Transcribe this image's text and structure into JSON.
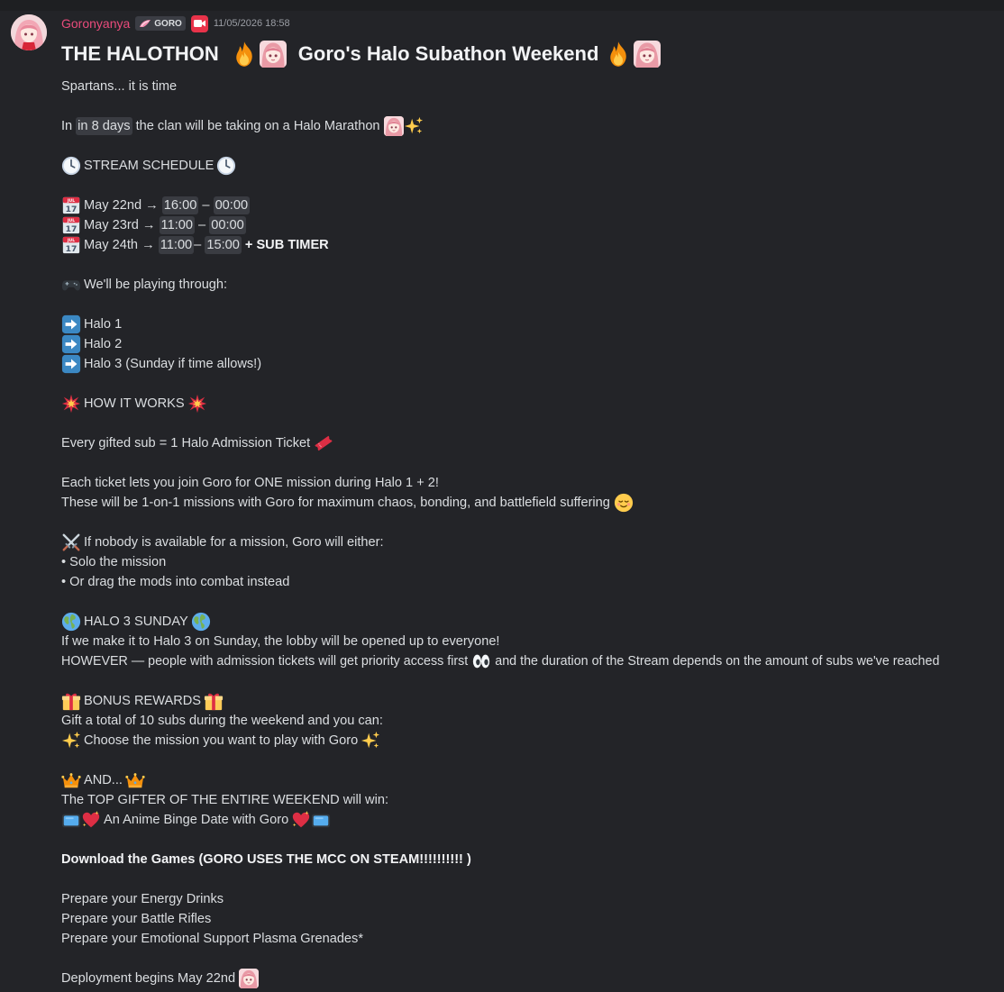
{
  "message": {
    "username": "Goronyanya",
    "tag": "GORO",
    "timestamp": "11/05/2026 18:58",
    "title": {
      "part1": "THE HALOTHON",
      "part2": "Goro's Halo Subathon Weekend"
    },
    "intro": "Spartans... it is time",
    "countdown": {
      "before": "In",
      "time": "in 8 days",
      "after": "the clan will be taking on a Halo Marathon"
    },
    "schedule_heading": "STREAM SCHEDULE",
    "schedule": [
      {
        "day": "May 22nd",
        "start": "16:00",
        "sep": " – ",
        "end": "00:00",
        "extra": ""
      },
      {
        "day": "May 23rd",
        "start": "11:00",
        "sep": " – ",
        "end": "00:00",
        "extra": ""
      },
      {
        "day": "May 24th",
        "start": "11:00",
        "sep": "– ",
        "end": "15:00",
        "extra": "+ SUB TIMER"
      }
    ],
    "arrow_sep": " → ",
    "playing_heading": "We'll be playing through:",
    "games": [
      "Halo 1",
      "Halo 2",
      "Halo 3 (Sunday if time allows!)"
    ],
    "how_heading": "HOW IT WORKS",
    "ticket_line": "Every gifted sub = 1 Halo Admission Ticket",
    "each_ticket": "Each ticket lets you join Goro for ONE mission during Halo 1 + 2!",
    "missions_line": "These will be 1-on-1 missions with Goro for maximum chaos, bonding, and battlefield suffering",
    "nobody_line": "If nobody is available for a mission, Goro will either:",
    "bullets": [
      "• Solo the mission",
      "• Or drag the mods into combat instead"
    ],
    "halo3_heading": "HALO 3 SUNDAY",
    "halo3_line": "If we make it to Halo 3 on Sunday, the lobby will be opened up to everyone!",
    "however_part1": "HOWEVER — people with admission tickets will get priority access first",
    "however_part2": "and the duration of the Stream depends on the amount of subs we've reached",
    "bonus_heading": "BONUS REWARDS",
    "bonus_line": "Gift a total of 10 subs during the weekend and you can:",
    "choose_line": "Choose the mission you want to play with Goro",
    "and_heading": "AND...",
    "top_gifter": "The TOP GIFTER OF THE ENTIRE WEEKEND will win:",
    "anime_line": "An Anime Binge Date with Goro",
    "download_line": "Download the Games (GORO USES THE MCC ON STEAM!!!!!!!!!! )",
    "prepare": [
      "Prepare your Energy Drinks",
      "Prepare your Battle Rifles",
      "Prepare your Emotional Support Plasma Grenades*"
    ],
    "deployment": "Deployment begins May 22nd"
  },
  "colors": {
    "background": "#232428",
    "username": "#e94b7b",
    "text": "#dbdee1",
    "timestamp_chip": "#3a3c42",
    "camera_badge": "#e8334a"
  },
  "icons": {
    "fire": "fire-icon",
    "anime_girl": "anime-girl-emoji-icon",
    "sparkles": "sparkles-icon",
    "clock": "clock-icon",
    "calendar": "calendar-icon",
    "controller": "game-controller-icon",
    "arrow": "right-arrow-icon",
    "collision": "collision-icon",
    "ticket": "ticket-icon",
    "relieved": "relieved-face-icon",
    "swords": "crossed-swords-icon",
    "globe": "globe-icon",
    "eyes": "eyes-icon",
    "gift": "gift-icon",
    "crown": "crown-icon",
    "tv": "tv-icon",
    "heart": "sparkling-heart-icon"
  }
}
